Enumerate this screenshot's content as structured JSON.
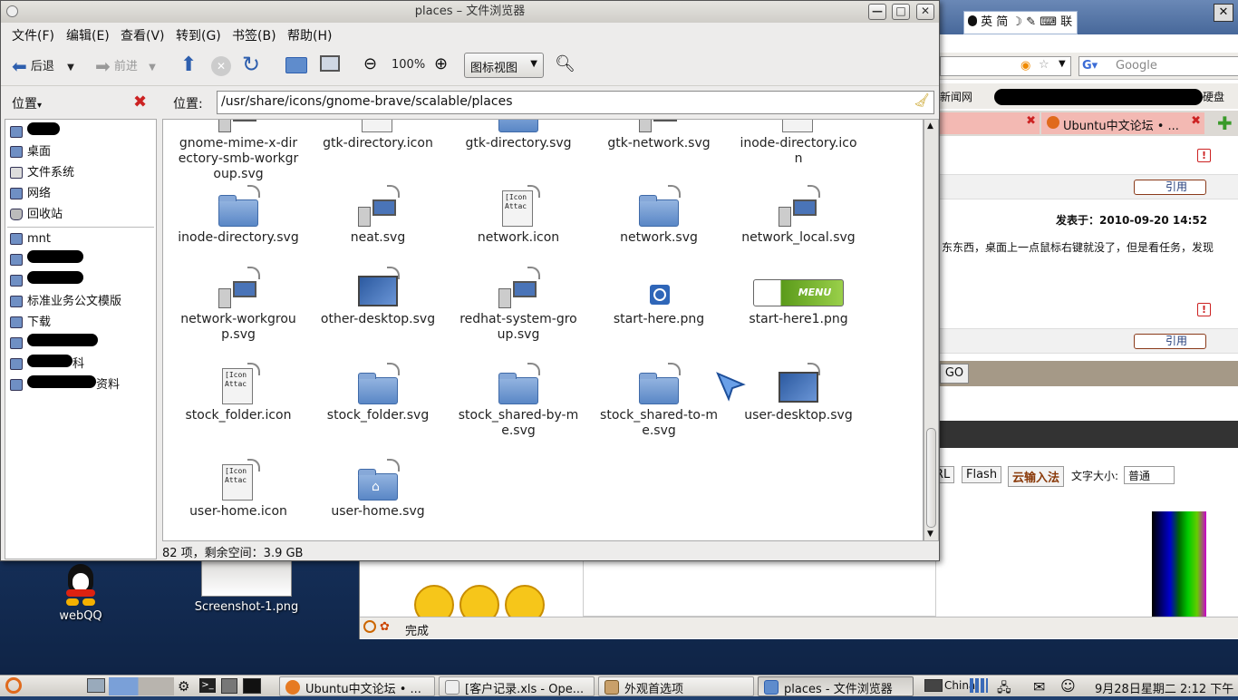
{
  "desktop": {
    "icons": [
      {
        "label": "webQQ"
      },
      {
        "label": "Screenshot-1.png"
      }
    ]
  },
  "firefox": {
    "search_placeholder": "Google",
    "bookmarks": {
      "item1": "新闻网",
      "item2": "硬盘"
    },
    "tabs": [
      {
        "label": "Ubuntu中文论坛 • ..."
      }
    ],
    "post": {
      "timestamp": "发表于：2010-09-20 14:52",
      "excerpt": "东东西，桌面上一点鼠标右键就没了，但是看任务，发现"
    },
    "quote_label": "引用",
    "go_button": "GO",
    "editor_buttons": [
      "RL",
      "Flash",
      "云输入法"
    ],
    "font_size_label": "文字大小:",
    "font_size_value": "普通",
    "status": "完成"
  },
  "ime": {
    "text": "英 简 ☽ ✎ ⌨ 联"
  },
  "filemanager": {
    "title": "places – 文件浏览器",
    "menu": [
      "文件(F)",
      "编辑(E)",
      "查看(V)",
      "转到(G)",
      "书签(B)",
      "帮助(H)"
    ],
    "toolbar": {
      "back": "后退",
      "forward": "前进",
      "zoom": "100%",
      "view_mode": "图标视图"
    },
    "location_label": "位置:",
    "location_value": "/usr/share/icons/gnome-brave/scalable/places",
    "sidebar_title": "位置",
    "sidebar_items": [
      "桌面",
      "文件系统",
      "网络",
      "回收站",
      "mnt",
      "标准业务公文模版",
      "下载"
    ],
    "sidebar_partial": [
      "科",
      "资料"
    ],
    "files": [
      {
        "name": "gnome-mime-x-directory-smb-workgroup.svg",
        "kind": "net"
      },
      {
        "name": "gtk-directory.icon",
        "kind": "doc"
      },
      {
        "name": "gtk-directory.svg",
        "kind": "folder"
      },
      {
        "name": "gtk-network.svg",
        "kind": "net"
      },
      {
        "name": "inode-directory.icon",
        "kind": "doc"
      },
      {
        "name": "inode-directory.svg",
        "kind": "folder"
      },
      {
        "name": "neat.svg",
        "kind": "net"
      },
      {
        "name": "network.icon",
        "kind": "doc"
      },
      {
        "name": "network.svg",
        "kind": "folder"
      },
      {
        "name": "network_local.svg",
        "kind": "net"
      },
      {
        "name": "network-workgroup.svg",
        "kind": "net"
      },
      {
        "name": "other-desktop.svg",
        "kind": "screen"
      },
      {
        "name": "redhat-system-group.svg",
        "kind": "net"
      },
      {
        "name": "start-here.png",
        "kind": "ubuntu"
      },
      {
        "name": "start-here1.png",
        "kind": "menu"
      },
      {
        "name": "stock_folder.icon",
        "kind": "doc"
      },
      {
        "name": "stock_folder.svg",
        "kind": "folder"
      },
      {
        "name": "stock_shared-by-me.svg",
        "kind": "folder"
      },
      {
        "name": "stock_shared-to-me.svg",
        "kind": "folder"
      },
      {
        "name": "user-desktop.svg",
        "kind": "screen"
      },
      {
        "name": "user-home.icon",
        "kind": "doc"
      },
      {
        "name": "user-home.svg",
        "kind": "home"
      }
    ],
    "doc_icon_text": "[Icon\nAttac",
    "menu_icon_text": "MENU",
    "status": "82 项，剩余空间：3.9 GB"
  },
  "taskbar": {
    "tasks": [
      {
        "label": "Ubuntu中文论坛 • ..."
      },
      {
        "label": "[客户记录.xls - Ope..."
      },
      {
        "label": "外观首选项"
      },
      {
        "label": "places - 文件浏览器"
      }
    ],
    "keyboard": "China",
    "clock": "9月28日星期二  2:12 下午"
  },
  "colors": {
    "accent": "#3f6aa8",
    "close_red": "#cc2222"
  }
}
